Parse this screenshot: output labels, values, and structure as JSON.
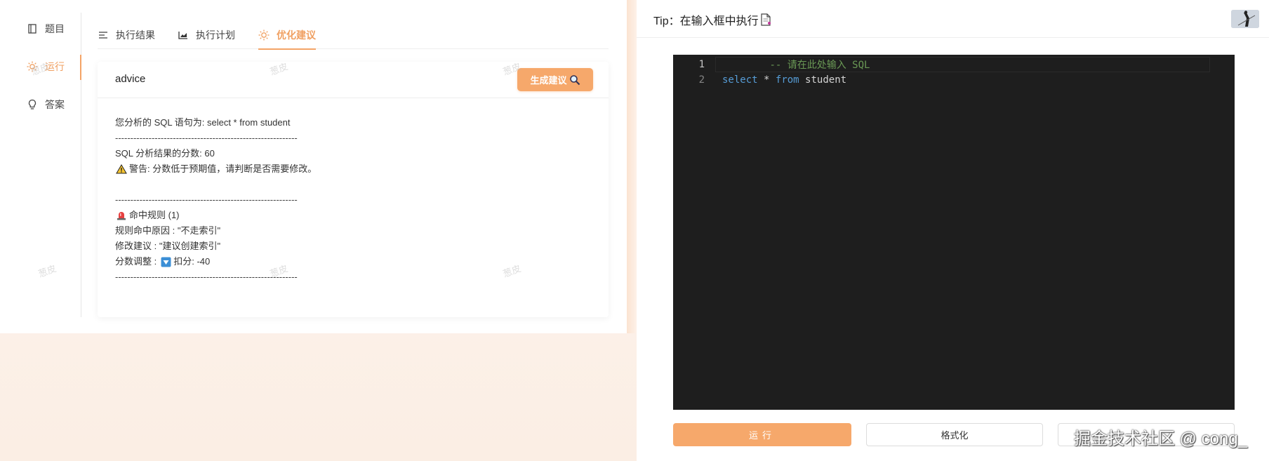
{
  "sidebar": {
    "items": [
      {
        "label": "题目",
        "icon": "book-icon"
      },
      {
        "label": "运行",
        "icon": "sun-icon"
      },
      {
        "label": "答案",
        "icon": "bulb-icon"
      }
    ],
    "active_index": 1
  },
  "tabs": [
    {
      "label": "执行结果",
      "icon": "list-icon"
    },
    {
      "label": "执行计划",
      "icon": "chart-icon"
    },
    {
      "label": "优化建议",
      "icon": "sun-icon"
    }
  ],
  "active_tab_index": 2,
  "advice_card": {
    "title": "advice",
    "generate_button": "生成建议",
    "lines": {
      "sql_statement": "您分析的 SQL 语句为: select * from student",
      "separator": "------------------------------------------------------------",
      "score": "SQL 分析结果的分数: 60",
      "warning": "警告: 分数低于预期值，请判断是否需要修改。",
      "rule_hit": "命中规则 (1)",
      "reason": "规则命中原因 : \"不走索引\"",
      "suggestion": "修改建议 : \"建议创建索引\"",
      "score_adjust_prefix": "分数调整 :",
      "score_adjust_value": "扣分: -40"
    }
  },
  "watermark_text": "葱皮",
  "tip": {
    "text": "Tip：在输入框中执行"
  },
  "editor": {
    "lines": [
      {
        "number": "1",
        "comment": "-- 请在此处输入 SQL"
      },
      {
        "number": "2",
        "kw1": "select",
        "op": "*",
        "kw2": "from",
        "ident": "student"
      }
    ]
  },
  "buttons": {
    "run": "运行",
    "format": "格式化",
    "third": ""
  },
  "footer_watermark": "掘金技术社区 @ cong_",
  "colors": {
    "accent": "#f6a86b",
    "active_text": "#f0a062",
    "editor_bg": "#1e1e1e",
    "comment": "#6a9955",
    "keyword": "#569cd6"
  }
}
